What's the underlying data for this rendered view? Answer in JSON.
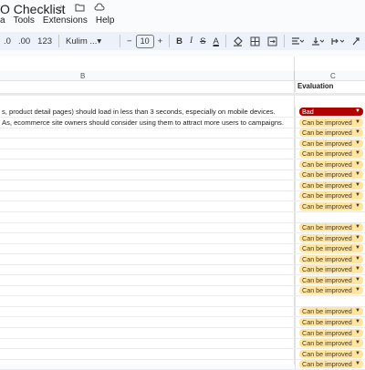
{
  "app": {
    "title": "O Checklist",
    "icons": [
      "star-icon",
      "move-to-folder-icon",
      "cloud-saved-icon"
    ]
  },
  "menu": [
    "a",
    "Tools",
    "Extensions",
    "Help"
  ],
  "toolbar": {
    "decimal_decrease": ".0",
    "decimal_increase": ".00",
    "number_format": "123",
    "font": "Kulim ...",
    "font_size": "10",
    "minus": "−",
    "plus": "+",
    "bold": "B",
    "italic": "I",
    "strike": "S",
    "text_color": "A"
  },
  "columns": {
    "b": "B",
    "c": "C"
  },
  "header": {
    "evaluation": "Evaluation"
  },
  "rows": [
    {
      "text": "s, product detail pages) should load in less than 3 seconds, especially on mobile devices.",
      "eval": "Bad",
      "status": "bad"
    },
    {
      "text": "As, ecommerce site owners should consider using them to attract more users to campaigns.",
      "eval": "Can be improved",
      "status": "improve"
    },
    {
      "text": "",
      "eval": "Can be improved",
      "status": "improve"
    },
    {
      "text": "",
      "eval": "Can be improved",
      "status": "improve"
    },
    {
      "text": "",
      "eval": "Can be improved",
      "status": "improve"
    },
    {
      "text": "",
      "eval": "Can be improved",
      "status": "improve"
    },
    {
      "text": "",
      "eval": "Can be improved",
      "status": "improve"
    },
    {
      "text": "",
      "eval": "Can be improved",
      "status": "improve"
    },
    {
      "text": "",
      "eval": "Can be improved",
      "status": "improve"
    },
    {
      "text": "",
      "eval": "Can be improved",
      "status": "improve"
    },
    {
      "text": "",
      "eval": "",
      "status": "empty"
    },
    {
      "text": "",
      "eval": "Can be improved",
      "status": "improve"
    },
    {
      "text": "",
      "eval": "Can be improved",
      "status": "improve"
    },
    {
      "text": "",
      "eval": "Can be improved",
      "status": "improve"
    },
    {
      "text": "",
      "eval": "Can be improved",
      "status": "improve"
    },
    {
      "text": "",
      "eval": "Can be improved",
      "status": "improve"
    },
    {
      "text": "",
      "eval": "Can be improved",
      "status": "improve"
    },
    {
      "text": "",
      "eval": "Can be improved",
      "status": "improve"
    },
    {
      "text": "",
      "eval": "",
      "status": "empty"
    },
    {
      "text": "",
      "eval": "Can be improved",
      "status": "improve"
    },
    {
      "text": "",
      "eval": "Can be improved",
      "status": "improve"
    },
    {
      "text": "",
      "eval": "Can be improved",
      "status": "improve"
    },
    {
      "text": "",
      "eval": "Can be improved",
      "status": "improve"
    },
    {
      "text": "",
      "eval": "Can be improved",
      "status": "improve"
    },
    {
      "text": "",
      "eval": "Can be improved",
      "status": "improve"
    }
  ]
}
